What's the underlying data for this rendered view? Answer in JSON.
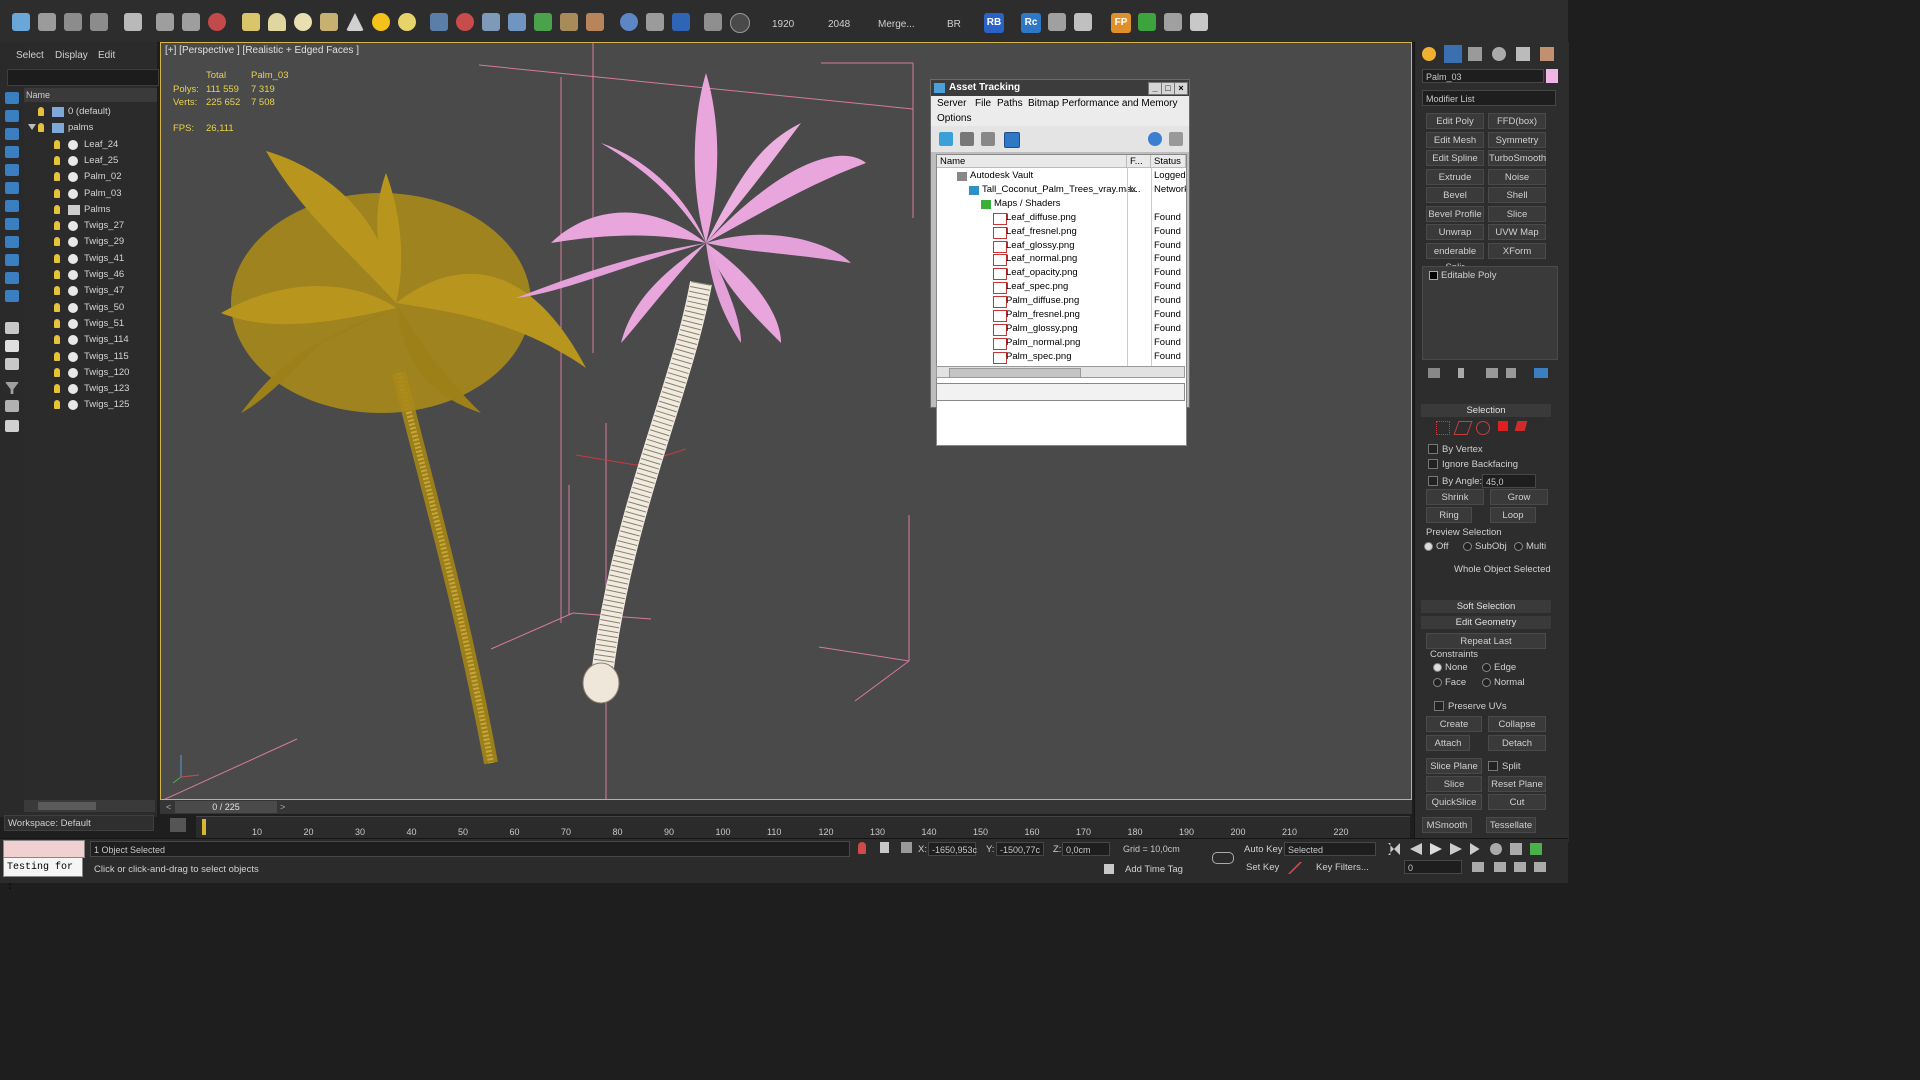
{
  "toolbar": {
    "render_width": "1920",
    "render_height": "2048",
    "merge_label": "Merge...",
    "br_label": "BR",
    "rb_label": "RB",
    "rc_label": "Rc",
    "fp_label": "FP"
  },
  "explorer": {
    "menu": [
      "Select",
      "Display",
      "Edit"
    ],
    "column_name": "Name",
    "items": [
      {
        "label": "0 (default)",
        "indent": 1,
        "kind": "layer"
      },
      {
        "label": "palms",
        "indent": 1,
        "kind": "layer"
      },
      {
        "label": "Leaf_24",
        "indent": 2,
        "kind": "object"
      },
      {
        "label": "Leaf_25",
        "indent": 2,
        "kind": "object"
      },
      {
        "label": "Palm_02",
        "indent": 2,
        "kind": "object"
      },
      {
        "label": "Palm_03",
        "indent": 2,
        "kind": "object"
      },
      {
        "label": "Palms",
        "indent": 2,
        "kind": "group"
      },
      {
        "label": "Twigs_27",
        "indent": 2,
        "kind": "object"
      },
      {
        "label": "Twigs_29",
        "indent": 2,
        "kind": "object"
      },
      {
        "label": "Twigs_41",
        "indent": 2,
        "kind": "object"
      },
      {
        "label": "Twigs_46",
        "indent": 2,
        "kind": "object"
      },
      {
        "label": "Twigs_47",
        "indent": 2,
        "kind": "object"
      },
      {
        "label": "Twigs_50",
        "indent": 2,
        "kind": "object"
      },
      {
        "label": "Twigs_51",
        "indent": 2,
        "kind": "object"
      },
      {
        "label": "Twigs_114",
        "indent": 2,
        "kind": "object"
      },
      {
        "label": "Twigs_115",
        "indent": 2,
        "kind": "object"
      },
      {
        "label": "Twigs_120",
        "indent": 2,
        "kind": "object"
      },
      {
        "label": "Twigs_123",
        "indent": 2,
        "kind": "object"
      },
      {
        "label": "Twigs_125",
        "indent": 2,
        "kind": "object"
      }
    ],
    "workspace": "Workspace: Default"
  },
  "viewport": {
    "label": "[+] [Perspective ] [Realistic + Edged Faces ]",
    "stats": {
      "col_total": "Total",
      "col_object": "Palm_03",
      "polys_label": "Polys:",
      "polys_total": "111 559",
      "polys_object": "7 319",
      "verts_label": "Verts:",
      "verts_total": "225 652",
      "verts_object": "7 508",
      "fps_label": "FPS:",
      "fps_value": "26,111"
    }
  },
  "asset_tracking": {
    "title": "Asset Tracking",
    "menu": [
      "Server",
      "File",
      "Paths",
      "Bitmap Performance and Memory",
      "Options"
    ],
    "columns": [
      "Name",
      "F...",
      "Status"
    ],
    "rows": [
      {
        "name": "Autodesk Vault",
        "f": "",
        "status": "Logged",
        "level": 0
      },
      {
        "name": "Tall_Coconut_Palm_Trees_vray.max",
        "f": "\\...",
        "status": "Network",
        "level": 1
      },
      {
        "name": "Maps / Shaders",
        "f": "",
        "status": "",
        "level": 2
      },
      {
        "name": "Leaf_diffuse.png",
        "f": "",
        "status": "Found",
        "level": 3
      },
      {
        "name": "Leaf_fresnel.png",
        "f": "",
        "status": "Found",
        "level": 3
      },
      {
        "name": "Leaf_glossy.png",
        "f": "",
        "status": "Found",
        "level": 3
      },
      {
        "name": "Leaf_normal.png",
        "f": "",
        "status": "Found",
        "level": 3
      },
      {
        "name": "Leaf_opacity.png",
        "f": "",
        "status": "Found",
        "level": 3
      },
      {
        "name": "Leaf_spec.png",
        "f": "",
        "status": "Found",
        "level": 3
      },
      {
        "name": "Palm_diffuse.png",
        "f": "",
        "status": "Found",
        "level": 3
      },
      {
        "name": "Palm_fresnel.png",
        "f": "",
        "status": "Found",
        "level": 3
      },
      {
        "name": "Palm_glossy.png",
        "f": "",
        "status": "Found",
        "level": 3
      },
      {
        "name": "Palm_normal.png",
        "f": "",
        "status": "Found",
        "level": 3
      },
      {
        "name": "Palm_spec.png",
        "f": "",
        "status": "Found",
        "level": 3
      }
    ]
  },
  "command_panel": {
    "object_name": "Palm_03",
    "modifier_list": "Modifier List",
    "modifier_buttons": [
      [
        "Edit Poly",
        "FFD(box)"
      ],
      [
        "Edit Mesh",
        "Symmetry"
      ],
      [
        "Edit Spline",
        "TurboSmooth"
      ],
      [
        "Extrude",
        "Noise"
      ],
      [
        "Bevel",
        "Shell"
      ],
      [
        "Bevel Profile",
        "Slice"
      ],
      [
        "Unwrap UVW",
        "UVW Map"
      ],
      [
        "enderable Splir",
        "XForm"
      ]
    ],
    "stack_item": "Editable Poly",
    "selection": {
      "title": "Selection",
      "by_vertex": "By Vertex",
      "ignore_backfacing": "Ignore Backfacing",
      "by_angle": "By Angle:",
      "angle_value": "45,0",
      "shrink": "Shrink",
      "grow": "Grow",
      "ring": "Ring",
      "loop": "Loop",
      "preview_selection": "Preview Selection",
      "preview_off": "Off",
      "preview_subobj": "SubObj",
      "preview_multi": "Multi",
      "whole_object": "Whole Object Selected"
    },
    "soft_selection": "Soft Selection",
    "edit_geometry": {
      "title": "Edit Geometry",
      "repeat_last": "Repeat Last",
      "constraints": "Constraints",
      "c_none": "None",
      "c_edge": "Edge",
      "c_face": "Face",
      "c_normal": "Normal",
      "preserve_uvs": "Preserve UVs",
      "create": "Create",
      "collapse": "Collapse",
      "attach": "Attach",
      "detach": "Detach",
      "slice_plane": "Slice Plane",
      "split": "Split",
      "slice": "Slice",
      "reset_plane": "Reset Plane",
      "quickslice": "QuickSlice",
      "cut": "Cut",
      "msmooth": "MSmooth",
      "tessellate": "Tessellate"
    }
  },
  "timeline": {
    "frame_slider": "0 / 225",
    "ticks": [
      "10",
      "20",
      "30",
      "40",
      "50",
      "60",
      "70",
      "80",
      "90",
      "100",
      "110",
      "120",
      "130",
      "140",
      "150",
      "160",
      "170",
      "180",
      "190",
      "200",
      "210",
      "220"
    ]
  },
  "status": {
    "maxscript": "Testing for :",
    "selected": "1 Object Selected",
    "prompt": "Click or click-and-drag to select objects",
    "x_label": "X:",
    "x_value": "-1650,953c",
    "y_label": "Y:",
    "y_value": "-1500,77c",
    "z_label": "Z:",
    "z_value": "0,0cm",
    "grid": "Grid = 10,0cm",
    "add_time_tag": "Add Time Tag",
    "auto_key": "Auto Key",
    "set_key": "Set Key",
    "selected_dropdown": "Selected",
    "key_filters": "Key Filters...",
    "frame_field": "0"
  },
  "colors": {
    "palm_left": "#a88a1a",
    "palm_right_leaves": "#e8a6dc",
    "viewport_bg": "#4a4a4a",
    "active_border": "#d3b54a",
    "stats_text": "#e8d34a"
  }
}
